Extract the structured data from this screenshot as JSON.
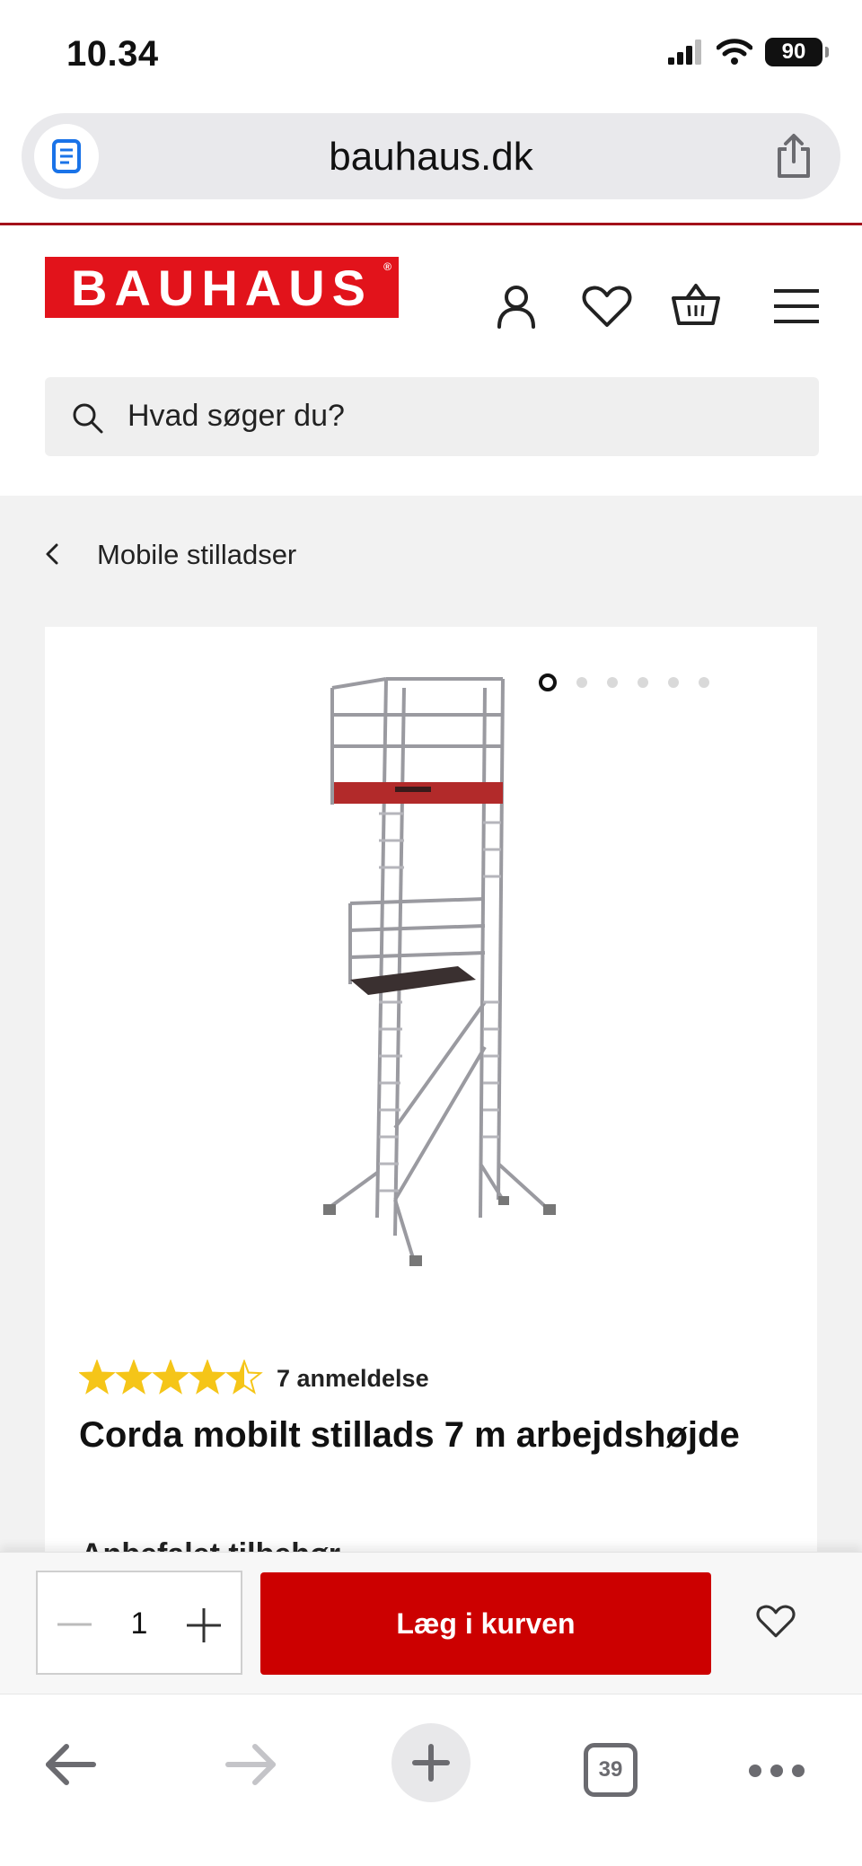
{
  "status_bar": {
    "time": "10.34",
    "battery": "90"
  },
  "browser": {
    "domain": "bauhaus.dk",
    "tab_count": "39"
  },
  "header": {
    "logo_text": "BAUHAUS",
    "logo_mark": "®",
    "search_placeholder": "Hvad søger du?",
    "icons": [
      "user-icon",
      "heart-icon",
      "basket-icon",
      "menu-icon"
    ]
  },
  "breadcrumb": {
    "label": "Mobile stilladser"
  },
  "product": {
    "image_count": 6,
    "active_image": 1,
    "rating": 4.5,
    "rating_max": 5,
    "review_count_label": "7 anmeldelse",
    "title": "Corda mobilt stillads 7 m arbejdshøjde",
    "next_section_title": "Anbefalet tilbehør"
  },
  "buy_bar": {
    "quantity": "1",
    "add_to_cart_label": "Læg i kurven"
  },
  "colors": {
    "brand_red": "#e2131b",
    "button_red": "#cc0000",
    "star": "#f5c518"
  }
}
